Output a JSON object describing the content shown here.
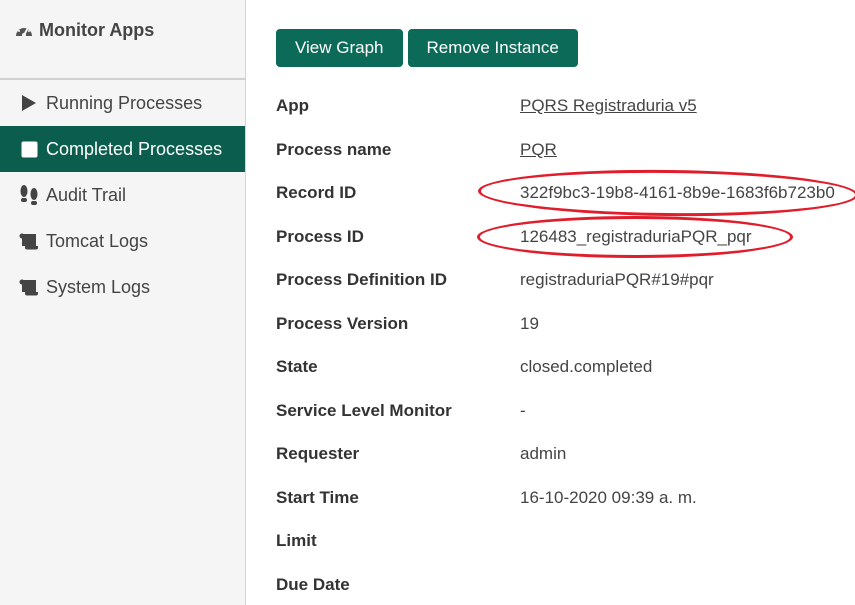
{
  "sidebar": {
    "title": "Monitor Apps",
    "title_icon": "dashboard-icon",
    "items": [
      {
        "label": "Running Processes",
        "icon": "play-icon",
        "active": false
      },
      {
        "label": "Completed Processes",
        "icon": "square-icon",
        "active": true
      },
      {
        "label": "Audit Trail",
        "icon": "footsteps-icon",
        "active": false
      },
      {
        "label": "Tomcat Logs",
        "icon": "scroll-icon",
        "active": false
      },
      {
        "label": "System Logs",
        "icon": "scroll-icon",
        "active": false
      }
    ]
  },
  "toolbar": {
    "view_graph_label": "View Graph",
    "remove_instance_label": "Remove Instance"
  },
  "details": [
    {
      "label": "App",
      "value": "PQRS Registraduria v5",
      "link": true
    },
    {
      "label": "Process name",
      "value": "PQR",
      "link": true
    },
    {
      "label": "Record ID",
      "value": "322f9bc3-19b8-4161-8b9e-1683f6b723b0",
      "link": false
    },
    {
      "label": "Process ID",
      "value": "126483_registraduriaPQR_pqr",
      "link": false
    },
    {
      "label": "Process Definition ID",
      "value": "registraduriaPQR#19#pqr",
      "link": false
    },
    {
      "label": "Process Version",
      "value": "19",
      "link": false
    },
    {
      "label": "State",
      "value": "closed.completed",
      "link": false
    },
    {
      "label": "Service Level Monitor",
      "value": "-",
      "link": false
    },
    {
      "label": "Requester",
      "value": "admin",
      "link": false
    },
    {
      "label": "Start Time",
      "value": "16-10-2020 09:39 a. m.",
      "link": false
    },
    {
      "label": "Limit",
      "value": "",
      "link": false
    },
    {
      "label": "Due Date",
      "value": "",
      "link": false
    }
  ],
  "colors": {
    "accent": "#0b6b58",
    "active_nav": "#0b5d4d",
    "annotation": "#e01d2b"
  }
}
